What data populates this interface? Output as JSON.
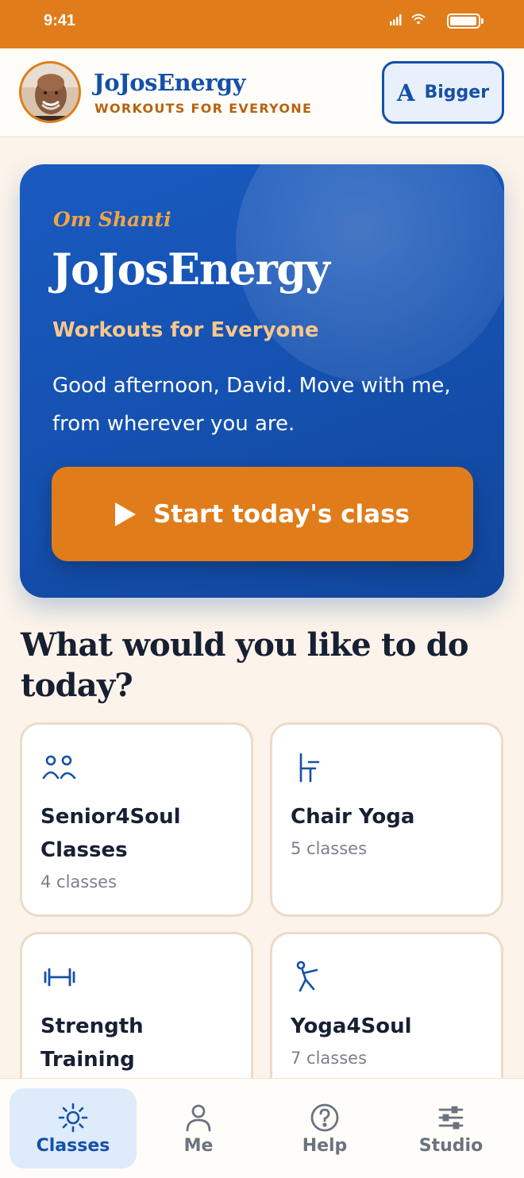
{
  "status_bar": {
    "time": "9:41"
  },
  "header": {
    "brand_title": "JoJosEnergy",
    "brand_subtitle": "WORKOUTS FOR EVERYONE",
    "text_size_button": {
      "glyph": "A",
      "label": "Bigger"
    }
  },
  "hero": {
    "kicker": "Om Shanti",
    "title": "JoJosEnergy",
    "subtitle": "Workouts for Everyone",
    "greeting": "Good afternoon, David. Move with me, from wherever you are.",
    "cta_label": "Start today's class"
  },
  "section": {
    "title": "What would you like to do today?",
    "categories": [
      {
        "name": "Senior4Soul Classes",
        "count": "4 classes",
        "icon": "people-icon"
      },
      {
        "name": "Chair Yoga",
        "count": "5 classes",
        "icon": "chair-icon"
      },
      {
        "name": "Strength Training",
        "count": "",
        "icon": "dumbbell-icon"
      },
      {
        "name": "Yoga4Soul",
        "count": "7 classes",
        "icon": "yoga-pose-icon"
      }
    ]
  },
  "tabs": [
    {
      "label": "Classes",
      "icon": "sun-icon",
      "active": true
    },
    {
      "label": "Me",
      "icon": "person-icon",
      "active": false
    },
    {
      "label": "Help",
      "icon": "help-icon",
      "active": false
    },
    {
      "label": "Studio",
      "icon": "sliders-icon",
      "active": false
    }
  ],
  "colors": {
    "status_bar": "#e07c1a",
    "brand_blue": "#1450a8",
    "accent_orange": "#e07c1a",
    "background": "#fcf4ea"
  }
}
